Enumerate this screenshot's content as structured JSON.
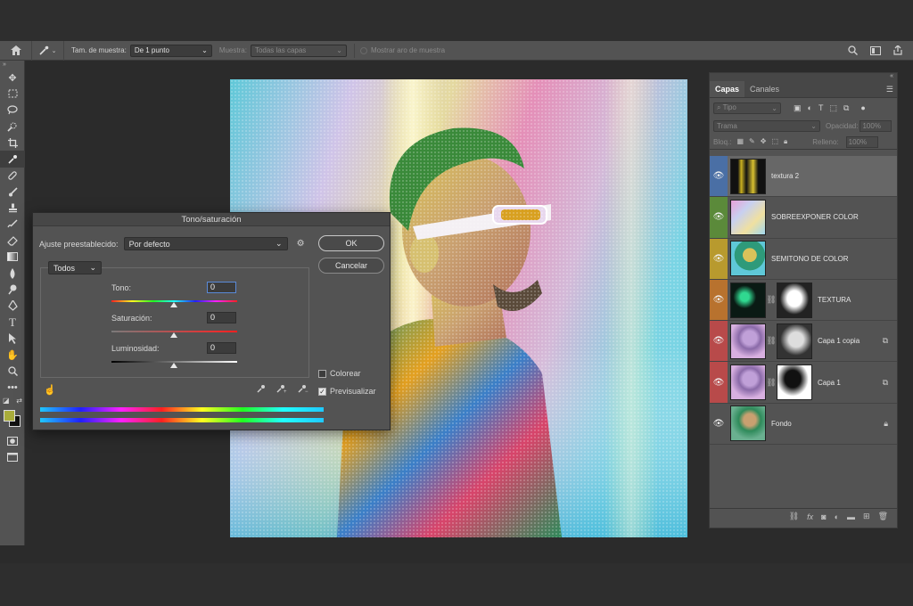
{
  "options_bar": {
    "sample_size_label": "Tam. de muestra:",
    "sample_size_value": "De 1 punto",
    "sample_label": "Muestra:",
    "sample_value": "Todas las capas",
    "show_ring_label": "Mostrar aro de muestra"
  },
  "toolbar": {
    "icons": [
      "move-icon",
      "marquee-icon",
      "lasso-icon",
      "quick-select-icon",
      "crop-icon",
      "eyedropper-icon",
      "healing-icon",
      "brush-icon",
      "stamp-icon",
      "history-brush-icon",
      "eraser-icon",
      "gradient-icon",
      "blur-icon",
      "dodge-icon",
      "pen-icon",
      "type-icon",
      "path-select-icon",
      "shape-icon",
      "hand-icon",
      "zoom-icon",
      "more-icon"
    ],
    "foreground_color": "#a9ac3a",
    "background_color": "#111111"
  },
  "dialog": {
    "title": "Tono/saturación",
    "preset_label": "Ajuste preestablecido:",
    "preset_value": "Por defecto",
    "ok_label": "OK",
    "cancel_label": "Cancelar",
    "range_value": "Todos",
    "hue_label": "Tono:",
    "hue_value": "0",
    "saturation_label": "Saturación:",
    "saturation_value": "0",
    "lightness_label": "Luminosidad:",
    "lightness_value": "0",
    "colorize_label": "Colorear",
    "colorize_checked": false,
    "preview_label": "Previsualizar",
    "preview_checked": true
  },
  "layers_panel": {
    "tab_layers": "Capas",
    "tab_channels": "Canales",
    "filter_placeholder": "Tipo",
    "blend_mode": "Trama",
    "opacity_label": "Opacidad:",
    "opacity_value": "100%",
    "lock_label": "Bloq.:",
    "fill_label": "Relleno:",
    "fill_value": "100%",
    "layers": [
      {
        "name": "textura 2",
        "color": "#4a6fa5",
        "selected": true
      },
      {
        "name": "SOBREEXPONER COLOR",
        "color": "#5b8a3a",
        "selected": false
      },
      {
        "name": "SEMITONO DE COLOR",
        "color": "#b89a2e",
        "selected": false
      },
      {
        "name": "TEXTURA",
        "color": "#b8722e",
        "selected": false
      },
      {
        "name": "Capa 1 copia",
        "color": "#b84a4a",
        "selected": false
      },
      {
        "name": "Capa 1",
        "color": "#b84a4a",
        "selected": false
      },
      {
        "name": "Fondo",
        "color": "#535353",
        "selected": false
      }
    ]
  }
}
